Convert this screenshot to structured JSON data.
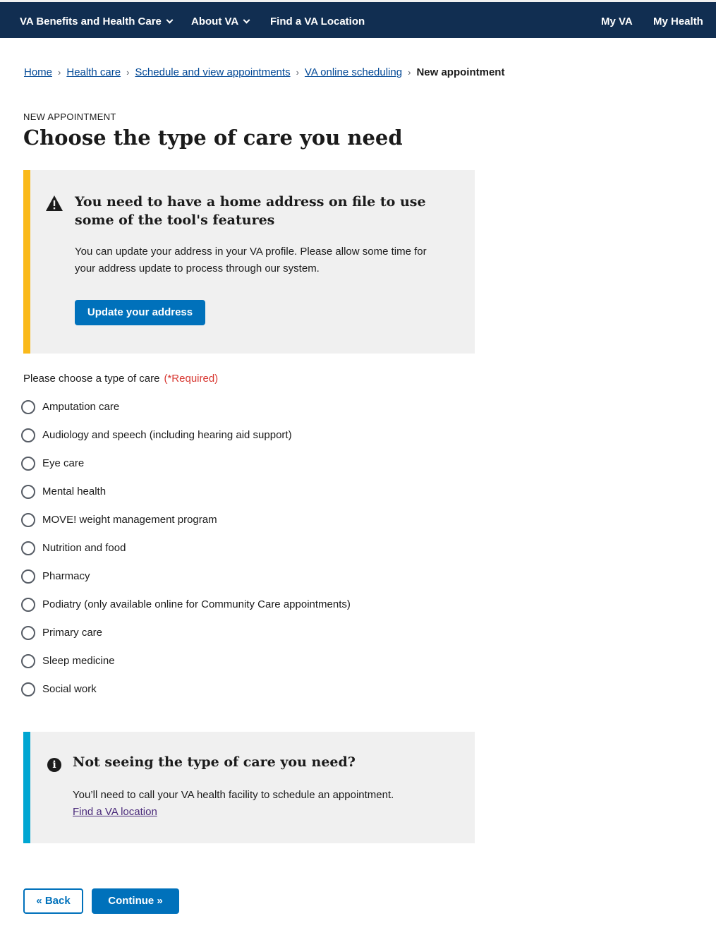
{
  "nav": {
    "benefits": "VA Benefits and Health Care",
    "about": "About VA",
    "find_location": "Find a VA Location",
    "my_va": "My VA",
    "my_health": "My Health"
  },
  "breadcrumb": {
    "home": "Home",
    "health_care": "Health care",
    "schedule": "Schedule and view appointments",
    "online_scheduling": "VA online scheduling",
    "current": "New appointment",
    "separator": "›"
  },
  "page": {
    "eyebrow": "NEW APPOINTMENT",
    "title": "Choose the type of care you need"
  },
  "warning_alert": {
    "heading": "You need to have a home address on file to use some of the tool's features",
    "body": "You can update your address in your VA profile. Please allow some time for your address update to process through our system.",
    "button": "Update your address",
    "border_color": "#fab91a"
  },
  "care_form": {
    "legend": "Please choose a type of care",
    "required": "(*Required)",
    "options": [
      "Amputation care",
      "Audiology and speech (including hearing aid support)",
      "Eye care",
      "Mental health",
      "MOVE! weight management program",
      "Nutrition and food",
      "Pharmacy",
      "Podiatry (only available online for Community Care appointments)",
      "Primary care",
      "Sleep medicine",
      "Social work"
    ]
  },
  "info_alert": {
    "heading": "Not seeing the type of care you need?",
    "body": "You’ll need to call your VA health facility to schedule an appointment.",
    "link": "Find a VA location",
    "icon_glyph": "i",
    "border_color": "#00a6d2"
  },
  "actions": {
    "back": "« Back",
    "continue": "Continue »"
  },
  "colors": {
    "nav_bg": "#112e51",
    "primary": "#0071bb",
    "required": "#d83933"
  }
}
